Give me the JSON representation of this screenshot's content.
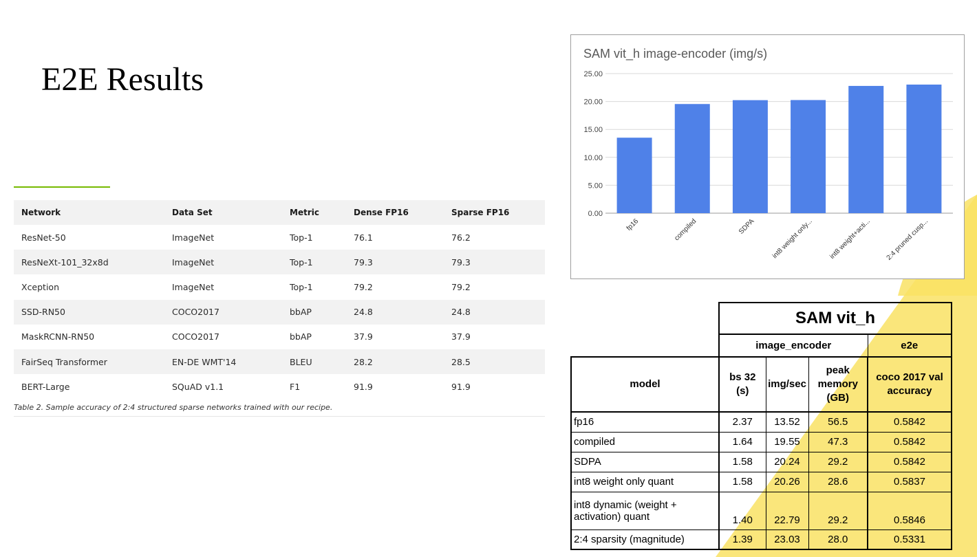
{
  "slide": {
    "title": "E2E Results"
  },
  "accuracy_table": {
    "headers": [
      "Network",
      "Data Set",
      "Metric",
      "Dense FP16",
      "Sparse FP16"
    ],
    "rows": [
      [
        "ResNet-50",
        "ImageNet",
        "Top-1",
        "76.1",
        "76.2"
      ],
      [
        "ResNeXt-101_32x8d",
        "ImageNet",
        "Top-1",
        "79.3",
        "79.3"
      ],
      [
        "Xception",
        "ImageNet",
        "Top-1",
        "79.2",
        "79.2"
      ],
      [
        "SSD-RN50",
        "COCO2017",
        "bbAP",
        "24.8",
        "24.8"
      ],
      [
        "MaskRCNN-RN50",
        "COCO2017",
        "bbAP",
        "37.9",
        "37.9"
      ],
      [
        "FairSeq Transformer",
        "EN-DE WMT'14",
        "BLEU",
        "28.2",
        "28.5"
      ],
      [
        "BERT-Large",
        "SQuAD v1.1",
        "F1",
        "91.9",
        "91.9"
      ]
    ],
    "caption": "Table 2. Sample accuracy of 2:4 structured sparse networks trained with our recipe."
  },
  "chart_data": {
    "type": "bar",
    "title": "SAM vit_h image-encoder (img/s)",
    "categories": [
      "fp16",
      "compiled",
      "SDPA",
      "int8 weight only...",
      "int8 weight+acti...",
      "2:4 pruned cusp..."
    ],
    "values": [
      13.52,
      19.55,
      20.24,
      20.26,
      22.79,
      23.03
    ],
    "ylim": [
      0,
      25
    ],
    "yticks": [
      "0.00",
      "5.00",
      "10.00",
      "15.00",
      "20.00",
      "25.00"
    ],
    "grid": true,
    "bar_color": "#4f81e8"
  },
  "sam_table": {
    "title": "SAM vit_h",
    "group_headers": [
      "image_encoder",
      "e2e"
    ],
    "col_headers": {
      "model": "model",
      "bs": [
        "bs 32",
        "(s)"
      ],
      "imgsec": "img/sec",
      "mem": [
        "peak",
        "memory",
        "(GB)"
      ],
      "acc": [
        "coco 2017 val",
        "accuracy"
      ]
    },
    "rows": [
      {
        "model": "fp16",
        "bs": "2.37",
        "imgsec": "13.52",
        "mem": "56.5",
        "acc": "0.5842"
      },
      {
        "model": "compiled",
        "bs": "1.64",
        "imgsec": "19.55",
        "mem": "47.3",
        "acc": "0.5842"
      },
      {
        "model": "SDPA",
        "bs": "1.58",
        "imgsec": "20.24",
        "mem": "29.2",
        "acc": "0.5842"
      },
      {
        "model": "int8 weight only quant",
        "bs": "1.58",
        "imgsec": "20.26",
        "mem": "28.6",
        "acc": "0.5837"
      },
      {
        "model_lines": [
          "int8 dynamic (weight +",
          "activation) quant"
        ],
        "bs": "1.40",
        "imgsec": "22.79",
        "mem": "29.2",
        "acc": "0.5846"
      },
      {
        "model": "2:4 sparsity (magnitude)",
        "bs": "1.39",
        "imgsec": "23.03",
        "mem": "28.0",
        "acc": "0.5331"
      }
    ]
  },
  "colors": {
    "accent_green": "#76b900",
    "decor_yellow": "#f9e264"
  }
}
